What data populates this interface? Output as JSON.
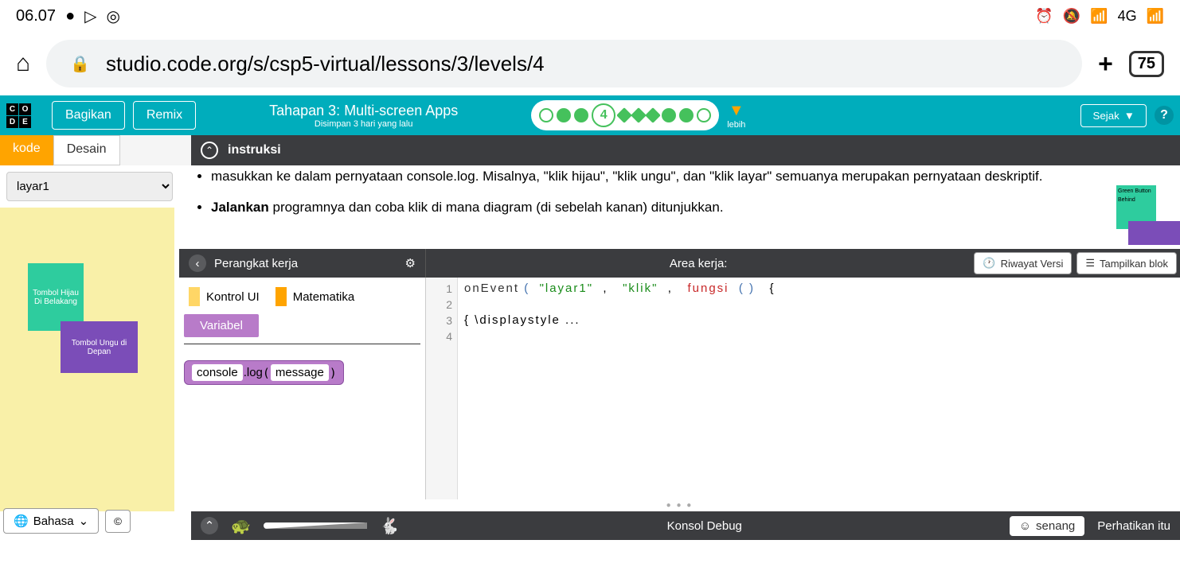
{
  "statusBar": {
    "time": "06.07",
    "network": "4G",
    "tabCount": "75"
  },
  "browser": {
    "url": "studio.code.org/s/csp5-virtual/lessons/3/levels/4"
  },
  "header": {
    "logo": [
      "C",
      "O",
      "",
      "D",
      "E",
      ""
    ],
    "share": "Bagikan",
    "remix": "Remix",
    "stageTitle": "Tahapan 3: Multi-screen Apps",
    "savedText": "Disimpan 3 hari yang lalu",
    "currentLevel": "4",
    "moreLabel": "lebih",
    "since": "Sejak"
  },
  "tabs": {
    "code": "kode",
    "design": "Desain",
    "instructions": "instruksi"
  },
  "leftPanel": {
    "screenSelect": "layar1",
    "greenButton": "Tombol Hijau Di Belakang",
    "purpleButton": "Tombol Ungu di Depan"
  },
  "instructions": {
    "line1a": "masukkan ke dalam pernyataan console.log. Misalnya, \"klik hijau\", \"klik ungu\", dan \"klik layar\" semuanya merupakan pernyataan deskriptif.",
    "line2bold": "Jalankan",
    "line2rest": " programnya dan coba klik di mana diagram (di sebelah kanan) ditunjukkan.",
    "diagGreen": "Green Button Behind"
  },
  "toolbox": {
    "title": "Perangkat kerja",
    "workspaceTitle": "Area kerja:",
    "versionHistory": "Riwayat Versi",
    "showBlocks": "Tampilkan blok",
    "categories": {
      "uiControl": "Kontrol UI",
      "math": "Matematika",
      "variable": "Variabel"
    },
    "block": {
      "console": "console",
      "log": ".log",
      "message": "message"
    }
  },
  "code": {
    "lines": [
      "1",
      "2",
      "3",
      "4"
    ],
    "l1": {
      "fn": "onEvent",
      "p1": "(",
      "s1": "\"layar1\"",
      "c1": ",",
      "s2": "\"klik\"",
      "c2": ",",
      "kw": "fungsi",
      "p2": "(",
      "p3": ")",
      "brace": "{"
    },
    "l3": "{ \\displaystyle ..."
  },
  "console": {
    "title": "Konsol Debug",
    "smile": "senang",
    "watch": "Perhatikan itu"
  },
  "footer": {
    "language": "Bahasa"
  }
}
